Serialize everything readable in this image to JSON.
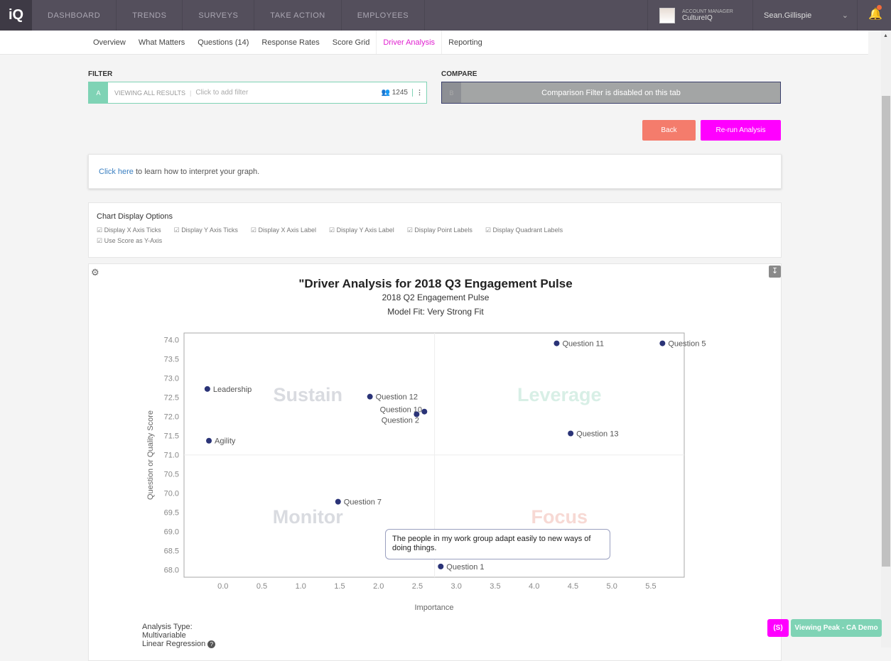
{
  "topnav": {
    "logo": "iQ",
    "items": [
      "DASHBOARD",
      "TRENDS",
      "SURVEYS",
      "TAKE ACTION",
      "EMPLOYEES"
    ],
    "account_label": "ACCOUNT MANAGER",
    "account_org": "CultureIQ",
    "user": "Sean.Gillispie"
  },
  "tabs": [
    {
      "label": "Overview"
    },
    {
      "label": "What Matters"
    },
    {
      "label": "Questions (14)"
    },
    {
      "label": "Response Rates"
    },
    {
      "label": "Score Grid"
    },
    {
      "label": "Driver Analysis",
      "active": true
    },
    {
      "label": "Reporting"
    }
  ],
  "filter": {
    "title": "FILTER",
    "letter": "A",
    "viewing": "VIEWING ALL RESULTS",
    "placeholder": "Click to add filter",
    "count": "1245"
  },
  "compare": {
    "title": "COMPARE",
    "letter": "B",
    "message": "Comparison Filter is disabled on this tab"
  },
  "buttons": {
    "back": "Back",
    "rerun": "Re-run Analysis"
  },
  "help": {
    "link": "Click here",
    "text": " to learn how to interpret your graph."
  },
  "options": {
    "title": "Chart Display Options",
    "items": [
      "Display X Axis Ticks",
      "Display Y Axis Ticks",
      "Display X Axis Label",
      "Display Y Axis Label",
      "Display Point Labels",
      "Display Quadrant Labels",
      "Use Score as Y-Axis"
    ]
  },
  "chart_data": {
    "type": "scatter",
    "title": "\"Driver Analysis for 2018 Q3 Engagement Pulse",
    "subtitle": "2018 Q2 Engagement Pulse",
    "model_fit": "Model Fit: Very Strong Fit",
    "xlabel": "Importance",
    "ylabel": "Question or Quality Score",
    "xlim": [
      -0.5,
      5.93
    ],
    "ylim": [
      67.81,
      74.18
    ],
    "xticks": [
      0.0,
      0.5,
      1.0,
      1.5,
      2.0,
      2.5,
      3.0,
      3.5,
      4.0,
      4.5,
      5.0,
      5.5
    ],
    "yticks": [
      68.0,
      68.5,
      69.0,
      69.5,
      70.0,
      70.5,
      71.0,
      71.5,
      72.0,
      72.5,
      73.0,
      73.5,
      74.0
    ],
    "quadrant_split": {
      "x": 2.72,
      "y": 71.0
    },
    "quadrants": [
      {
        "label": "Sustain",
        "color": "#d9dbe0"
      },
      {
        "label": "Leverage",
        "color": "#d8efe6"
      },
      {
        "label": "Monitor",
        "color": "#d9dbe0"
      },
      {
        "label": "Focus",
        "color": "#f7d9d4"
      }
    ],
    "point_color": "#2a3377",
    "points": [
      {
        "label": "Leadership",
        "x": -0.2,
        "y": 72.72
      },
      {
        "label": "Agility",
        "x": -0.18,
        "y": 71.37
      },
      {
        "label": "Question 12",
        "x": 1.89,
        "y": 72.52
      },
      {
        "label": "Question 10",
        "x": 2.59,
        "y": 72.13
      },
      {
        "label": "Question 2",
        "x": 2.49,
        "y": 72.06
      },
      {
        "label": "Question 7",
        "x": 1.48,
        "y": 69.78
      },
      {
        "label": "Question 1",
        "x": 2.8,
        "y": 68.09
      },
      {
        "label": "Question 11",
        "x": 4.29,
        "y": 73.91
      },
      {
        "label": "Question 5",
        "x": 5.65,
        "y": 73.91
      },
      {
        "label": "Question 13",
        "x": 4.47,
        "y": 71.56
      }
    ],
    "tooltip": "The people in my work group adapt easily to new ways of doing things."
  },
  "analysis": {
    "label": "Analysis Type:",
    "line1": "Multivariable",
    "line2": "Linear Regression"
  },
  "badges": {
    "s": "(S)",
    "viewing": "Viewing Peak - CA Demo"
  },
  "colors": {
    "accent": "#ff00ff",
    "back": "#f47c6c",
    "teal": "#7fd3b5",
    "nav": "#544f5c"
  }
}
